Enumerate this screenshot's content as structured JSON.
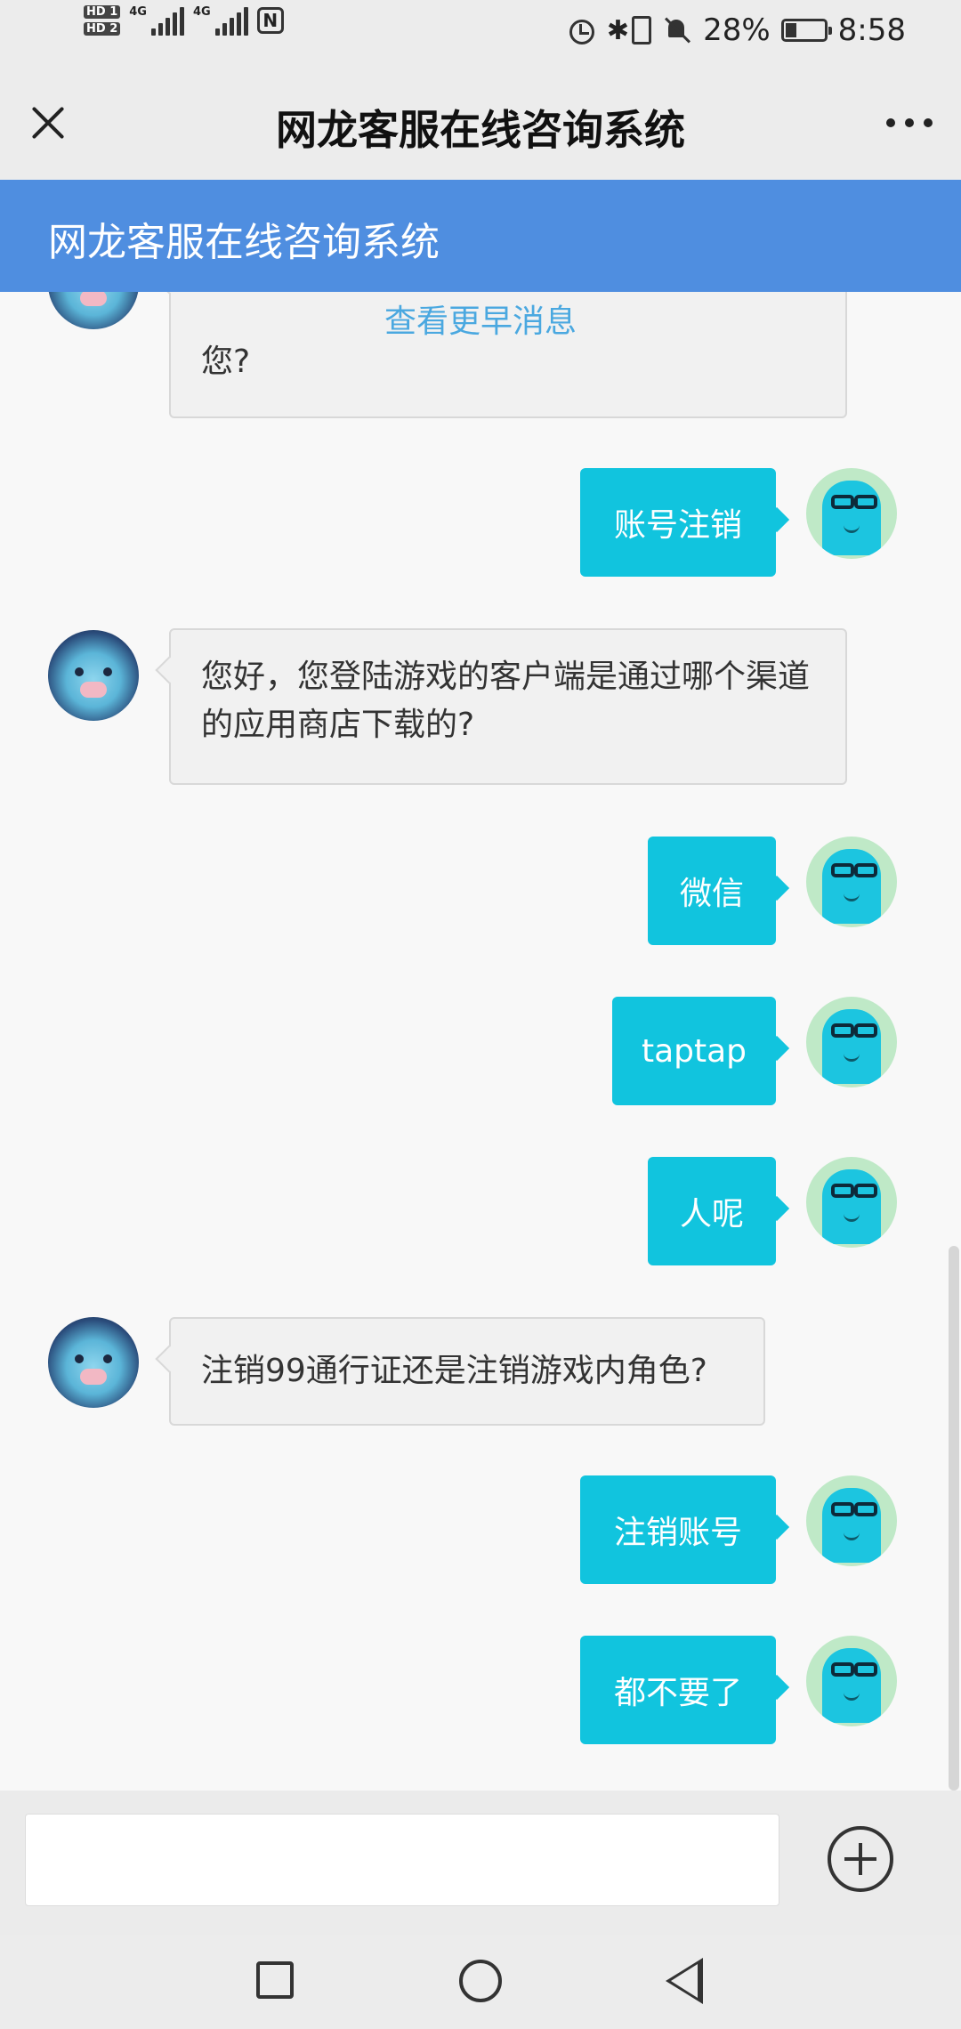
{
  "status_bar": {
    "hd1": "HD 1",
    "hd2": "HD 2",
    "sim1_net": "4G",
    "sim2_net": "4G",
    "battery_pct": "28%",
    "battery_level": 0.28,
    "time": "8:58",
    "icons": [
      "nfc-icon",
      "alarm-icon",
      "bluetooth-icon",
      "vibrate-icon",
      "mute-icon",
      "battery-charging-icon"
    ]
  },
  "title_bar": {
    "title": "网龙客服在线咨询系统",
    "close_icon": "close-icon",
    "more_icon": "more-icon"
  },
  "header": {
    "title": "网龙客服在线咨询系统",
    "bg_color": "#4f8ee0"
  },
  "chat": {
    "load_more": "查看更早消息",
    "messages": [
      {
        "from": "agent",
        "text": "您?"
      },
      {
        "from": "user",
        "text": "账号注销"
      },
      {
        "from": "agent",
        "text": "您好，您登陆游戏的客户端是通过哪个渠道的应用商店下载的?"
      },
      {
        "from": "user",
        "text": "微信"
      },
      {
        "from": "user",
        "text": "taptap"
      },
      {
        "from": "user",
        "text": "人呢"
      },
      {
        "from": "agent",
        "text": "注销99通行证还是注销游戏内角色?"
      },
      {
        "from": "user",
        "text": "注销账号"
      },
      {
        "from": "user",
        "text": "都不要了"
      }
    ],
    "user_bubble_color": "#11c4de",
    "agent_bubble_color": "#f1f1f1"
  },
  "input": {
    "value": "",
    "placeholder": "",
    "add_icon": "plus-circle-icon"
  },
  "nav_bar": {
    "icons": [
      "recent-apps-icon",
      "home-icon",
      "back-icon"
    ]
  }
}
